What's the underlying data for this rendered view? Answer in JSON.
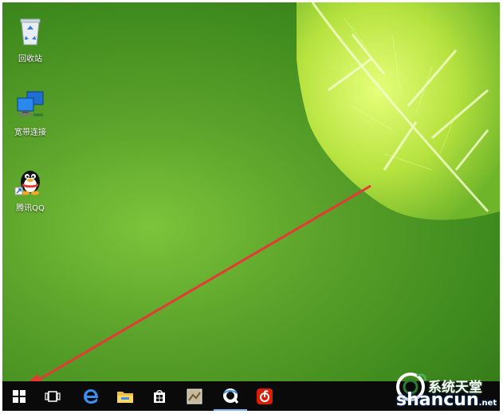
{
  "desktop": {
    "icons": [
      {
        "name": "recycle-bin",
        "label": "回收站"
      },
      {
        "name": "broadband",
        "label": "宽带连接"
      },
      {
        "name": "tencent-qq",
        "label": "腾讯QQ"
      }
    ]
  },
  "taskbar": {
    "items": [
      "start",
      "task-view",
      "edge",
      "file-explorer",
      "store",
      "app",
      "qq-browser",
      "netease-music"
    ]
  },
  "watermark": {
    "top": "系统天堂",
    "main": "shancun",
    "suffix": ".net"
  },
  "colors": {
    "arrow": "#e53935",
    "taskbar": "#0a0a0a",
    "active_indicator": "#7eb6ff"
  }
}
